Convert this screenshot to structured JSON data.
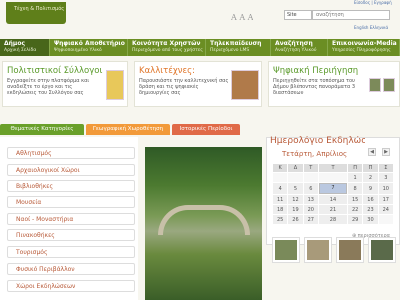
{
  "header": {
    "logo_text": "Τέχνη & Πολιτισμός",
    "font_size": "Α Α Α",
    "search_select": "Site",
    "search_value": "αναζήτηση",
    "login": "Είσοδος | Εγγραφή",
    "languages": "English  Ελληνικά"
  },
  "nav": [
    {
      "label": "Δήμος",
      "sub": "Αρχική Σελίδα"
    },
    {
      "label": "Ψηφιακό Αποθετήριο",
      "sub": "Ψηφιοποιημένο Υλικό"
    },
    {
      "label": "Κοινότητα Χρηστών",
      "sub": "Περιεχόμενο από τους χρήστες"
    },
    {
      "label": "Τηλεκπαίδευση",
      "sub": "Περιεχόμενο LMS"
    },
    {
      "label": "Αναζήτηση",
      "sub": "Αναζήτηση Υλικού"
    },
    {
      "label": "Επικοινωνία-Media",
      "sub": "Υπηρεσίες Πληροφόρησης"
    }
  ],
  "cards": [
    {
      "title": "Πολιτιστικοί Σύλλογοι",
      "desc": "Εγγραφείτε στην πλατφόρμα και αναδείξτε το έργο και τις εκδηλώσεις του Συλλόγου σας"
    },
    {
      "title": "Καλλιτέχνες:",
      "desc": "Παρουσιάστε την καλλιτεχνική σας δράση και τις ψηφιακές δημιουργίες σας"
    },
    {
      "title": "Ψηφιακή Περιήγηση",
      "desc": "Περιηγηθείτε στα τοπόσημα του Δήμου βλέποντας πανοράματα 3 διαστάσεων"
    }
  ],
  "tabs": [
    "Θεματικές Κατηγορίες",
    "Γεωγραφική Χωροθέτηση",
    "Ιστορικές Περίοδοι"
  ],
  "categories": [
    "Αθλητισμός",
    "Αρχαιολογικοί Χώροι",
    "Βιβλιοθήκες",
    "Μουσεία",
    "Ναοί - Μοναστήρια",
    "Πινακοθήκες",
    "Τουρισμός",
    "Φυσικό Περιβάλλον",
    "Χώροι Εκδηλώσεων"
  ],
  "calendar": {
    "title": "Ημερολόγιο Εκδηλώσεων",
    "date": "Τετάρτη, Απρίλιος",
    "weekdays": [
      "Κ",
      "Δ",
      "Τ",
      "Τ",
      "Π",
      "Π",
      "Σ"
    ],
    "weeks": [
      [
        "",
        "",
        "",
        "",
        "1",
        "2",
        "3"
      ],
      [
        "4",
        "5",
        "6",
        "7",
        "8",
        "9",
        "10"
      ],
      [
        "11",
        "12",
        "13",
        "14",
        "15",
        "16",
        "17"
      ],
      [
        "18",
        "19",
        "20",
        "21",
        "22",
        "23",
        "24"
      ],
      [
        "25",
        "26",
        "27",
        "28",
        "29",
        "30",
        ""
      ]
    ],
    "selected_day": "7",
    "more": "περισσότερα"
  },
  "colors": {
    "nav": "#6b8e23",
    "accent": "#b85a38",
    "tab_green": "#6aa02a",
    "tab_orange": "#f29a3a",
    "tab_red": "#e06a48"
  }
}
